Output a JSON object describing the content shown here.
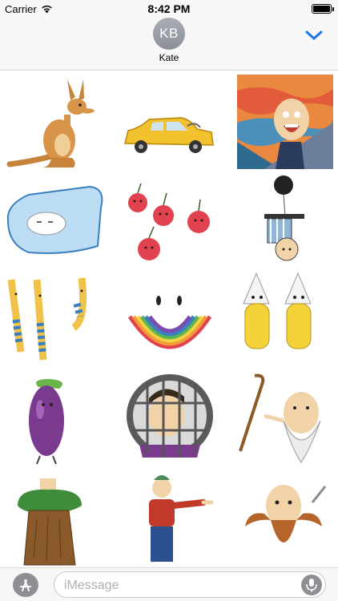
{
  "status_bar": {
    "carrier": "Carrier",
    "time": "8:42 PM",
    "wifi_icon": "wifi-icon",
    "battery_icon": "battery-icon"
  },
  "header": {
    "avatar_initials": "KB",
    "contact_name": "Kate",
    "collapse_icon": "chevron-down-icon"
  },
  "stickers": [
    "kangaroo",
    "yellow-taxi",
    "scream-parody",
    "sleeping-pillow",
    "running-cherries",
    "balloon-man",
    "striped-socks",
    "rainbow-smile",
    "corn-ghosts",
    "eggplant",
    "boy-behind-bars",
    "old-man-cane",
    "tree-costume",
    "pointing-man",
    "mustache-wizard"
  ],
  "compose": {
    "appstore_icon": "app-store-icon",
    "placeholder": "iMessage",
    "mic_icon": "microphone-icon"
  },
  "colors": {
    "accent": "#1a73e8",
    "avatar": "#9da1a9",
    "bar_background": "#f7f7f7"
  }
}
